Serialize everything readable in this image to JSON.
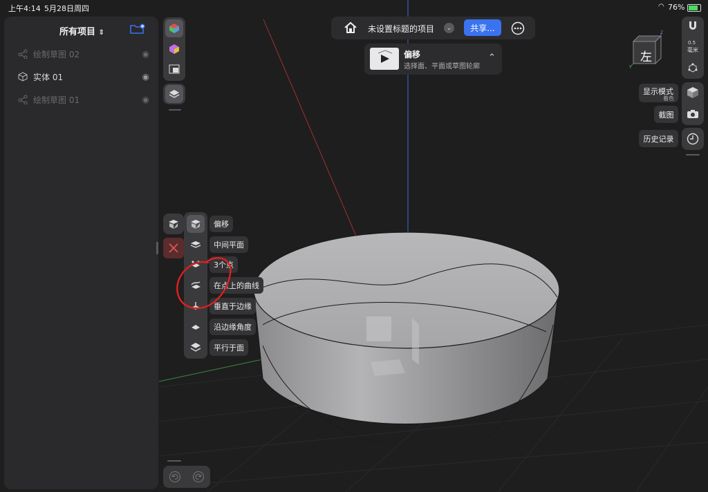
{
  "status_bar": {
    "time": "上午4:14",
    "date": "5月28日周四",
    "battery_percent": "76%",
    "wifi_icon": "wifi-icon",
    "battery_icon": "battery-charging-icon"
  },
  "left_panel": {
    "title": "所有项目",
    "title_chevron": "⌃",
    "items": [
      {
        "label": "绘制草图 02",
        "icon": "sketch-icon",
        "visible": false
      },
      {
        "label": "实体  01",
        "icon": "solid-cube-icon",
        "visible": true
      },
      {
        "label": "绘制草图 01",
        "icon": "sketch-icon",
        "visible": false
      }
    ]
  },
  "top_bar": {
    "project_title": "未设置标题的项目",
    "share_label": "共享...",
    "more_icon": "ellipsis-icon",
    "home_icon": "home-icon"
  },
  "operation_card": {
    "title": "偏移",
    "subtitle": "选择面、平面或草图轮廓"
  },
  "view_cube": {
    "face_label": "左",
    "axis_z": "Z",
    "axis_y": "Y"
  },
  "right_toolbar": {
    "snap_value": "0.5",
    "snap_unit": "毫米",
    "display_mode_label": "显示模式",
    "display_mode_value": "着色",
    "screenshot_label": "截图",
    "history_label": "历史记录"
  },
  "offset_menu": {
    "items": [
      {
        "label": "偏移",
        "icon": "offset-icon"
      },
      {
        "label": "中间平面",
        "icon": "mid-plane-icon"
      },
      {
        "label": "3个点",
        "icon": "three-points-icon"
      },
      {
        "label": "在点上的曲线",
        "icon": "curve-at-point-icon"
      },
      {
        "label": "垂直于边缘",
        "icon": "perpendicular-edge-icon"
      },
      {
        "label": "沿边缘角度",
        "icon": "edge-angle-icon"
      },
      {
        "label": "平行于面",
        "icon": "parallel-face-icon"
      }
    ]
  },
  "colors": {
    "accent": "#3a72f0",
    "annotation": "#e02020",
    "background": "#1e1e1f",
    "panel": "#2a2a2c"
  }
}
